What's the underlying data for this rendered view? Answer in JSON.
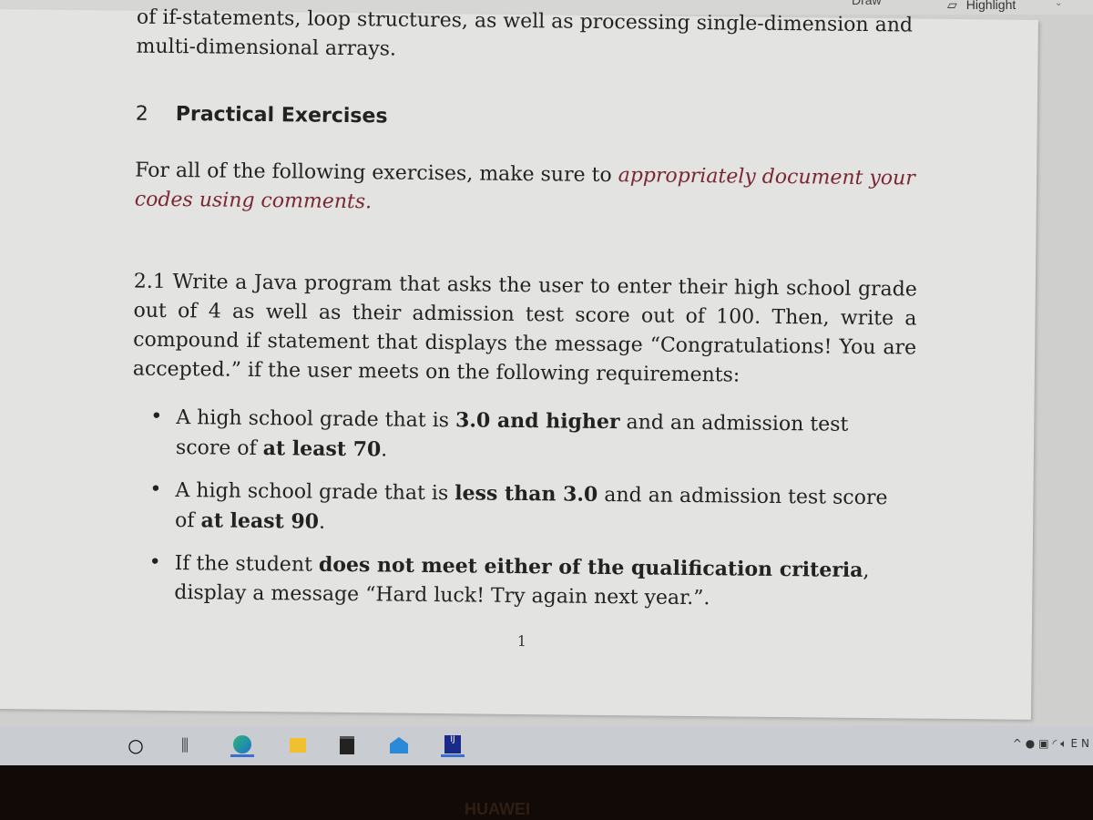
{
  "toolbar": {
    "draw_label": "Draw",
    "highlight_label": "Highlight"
  },
  "document": {
    "intro": "of if-statements, loop structures, as well as processing single-dimension and multi-dimensional arrays.",
    "section_number": "2",
    "section_title": "Practical Exercises",
    "instructions_prefix": "For all of the following exercises, make sure to ",
    "instructions_emphasis": "appropriately document your codes using comments.",
    "question": "2.1 Write a Java program that asks the user to enter their high school grade out of 4 as well as their admission test score out of 100. Then, write a compound if statement that displays the message “Congratulations! You are accepted.” if the user meets on the following requirements:",
    "bullets": [
      [
        "A high school grade that is ",
        "3.0 and higher",
        " and an admission test score of ",
        "at least 70",
        "."
      ],
      [
        "A high school grade that is ",
        "less than 3.0",
        " and an admission test score of ",
        "at least 90",
        "."
      ],
      [
        "If the student ",
        "does not meet either of the qualification criteria",
        ", display a message “Hard luck! Try again next year.”.",
        "",
        ""
      ]
    ],
    "page_number": "1"
  },
  "taskbar": {
    "apps": [
      "cortana-icon",
      "task-view-icon",
      "edge-icon",
      "file-explorer-icon",
      "store-icon",
      "mail-icon",
      "intellij-icon"
    ],
    "tray_language": "EN"
  },
  "bezel": {
    "brand": "HUAWEI"
  }
}
